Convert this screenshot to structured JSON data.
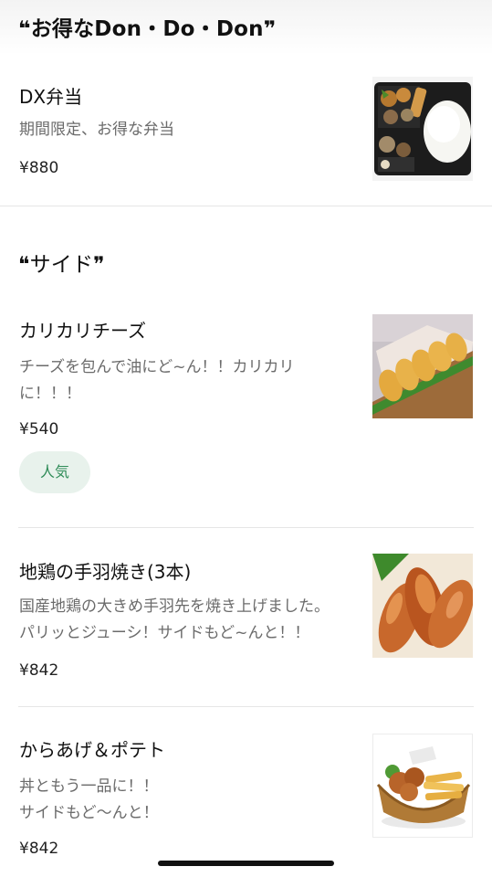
{
  "sections": {
    "deal": {
      "title": "❝お得なDon・Do・Don❞"
    },
    "side": {
      "title": "❝サイド❞"
    }
  },
  "items": [
    {
      "name": "DX弁当",
      "description": "期間限定、お得な弁当",
      "price": "¥880",
      "badge": ""
    },
    {
      "name": "カリカリチーズ",
      "description": "チーズを包んで油にど~ん！！カリカリ\nに！！！",
      "price": "¥540",
      "badge": "人気"
    },
    {
      "name": "地鶏の手羽焼き(3本)",
      "description": "国産地鶏の大きめ手羽先を焼き上げました。\nパリッとジューシ！サイドもど~んと！！",
      "price": "¥842",
      "badge": ""
    },
    {
      "name": "からあげ＆ポテト",
      "description": "丼ともう一品に！！\nサイドもど〜んと！",
      "price": "¥842",
      "badge": ""
    }
  ],
  "icons": {
    "item1": "bento-photo",
    "item2": "fried-cheese-photo",
    "item3": "chicken-wings-photo",
    "item4": "karaage-fries-photo"
  },
  "colors": {
    "badge_bg": "#e8f2ec",
    "badge_text": "#2e8b57",
    "desc_text": "#6b6b6b"
  }
}
